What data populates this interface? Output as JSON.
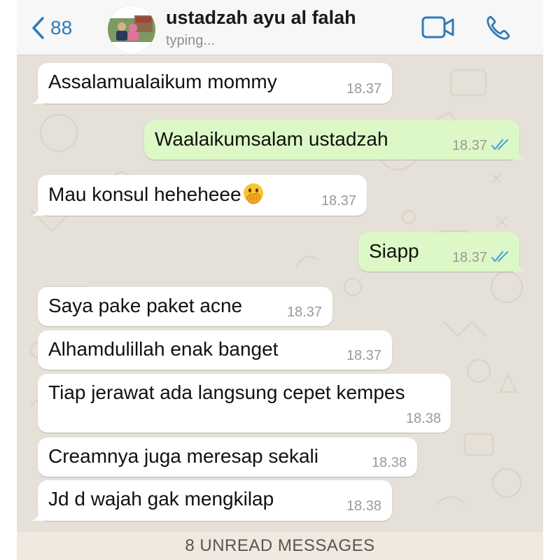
{
  "header": {
    "back_count": "88",
    "contact_name": "ustadzah ayu al falah",
    "status": "typing...",
    "accent_color": "#2f7bb8"
  },
  "messages": [
    {
      "direction": "incoming",
      "text": "Assalamualaikum mommy",
      "time": "18.37"
    },
    {
      "direction": "outgoing",
      "text": "Waalaikumsalam ustadzah",
      "time": "18.37",
      "read": true
    },
    {
      "direction": "incoming",
      "text": "Mau konsul heheheee",
      "emoji": "hand-over-mouth",
      "time": "18.37"
    },
    {
      "direction": "outgoing",
      "text": "Siapp",
      "time": "18.37",
      "read": true
    },
    {
      "direction": "incoming",
      "text": "Saya pake paket acne",
      "time": "18.37"
    },
    {
      "direction": "incoming",
      "text": "Alhamdulillah enak banget",
      "time": "18.37"
    },
    {
      "direction": "incoming",
      "text": "Tiap jerawat ada langsung cepet kempes",
      "time": "18.38"
    },
    {
      "direction": "incoming",
      "text": "Creamnya juga meresap sekali",
      "time": "18.38"
    },
    {
      "direction": "incoming",
      "text": "Jd d wajah gak mengkilap",
      "time": "18.38"
    }
  ],
  "unread_banner": "8 UNREAD MESSAGES",
  "colors": {
    "incoming_bubble": "#ffffff",
    "outgoing_bubble": "#dcf8c6",
    "wallpaper": "#e6e1d8",
    "read_ticks": "#4fa3e0"
  }
}
